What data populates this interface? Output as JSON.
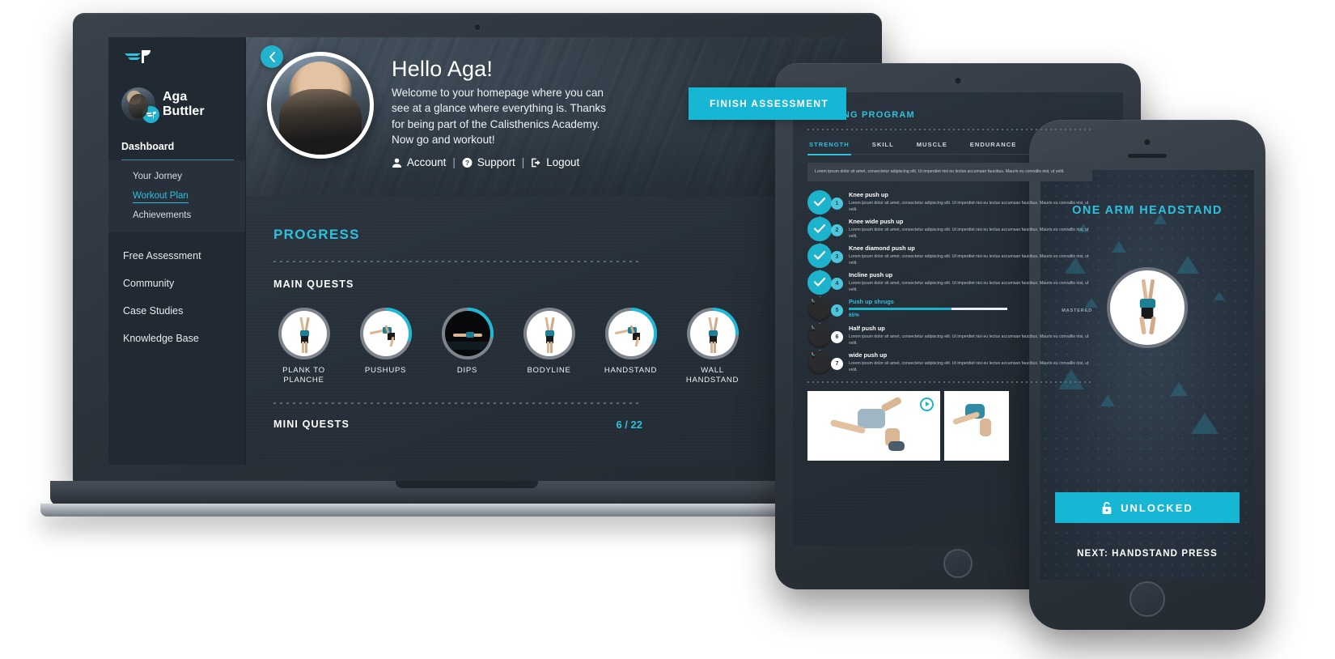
{
  "brand": {
    "logo_icon": "wing-logo-icon",
    "accent": "#22b2cd",
    "accent_dark": "#16b6d4"
  },
  "laptop": {
    "back_button_icon": "chevron-left-icon",
    "sidebar": {
      "user": {
        "name_line1": "Aga",
        "name_line2": "Buttler",
        "badge_icon": "wing-badge-icon"
      },
      "section_label": "Dashboard",
      "sub_items": [
        {
          "label": "Your Jorney",
          "active": false
        },
        {
          "label": "Workout Plan",
          "active": true
        },
        {
          "label": "Achievements",
          "active": false
        }
      ],
      "items": [
        {
          "label": "Free Assessment"
        },
        {
          "label": "Community"
        },
        {
          "label": "Case Studies"
        },
        {
          "label": "Knowledge Base"
        }
      ]
    },
    "hero": {
      "greeting": "Hello Aga!",
      "welcome": "Welcome to your homepage where you can see at a glance where everything is. Thanks for being part of the Calisthenics Academy. Now go and workout!",
      "links": [
        {
          "label": "Account",
          "icon": "user-icon"
        },
        {
          "label": "Support",
          "icon": "question-circle-icon"
        },
        {
          "label": "Logout",
          "icon": "logout-icon"
        }
      ],
      "separator": "|",
      "cta_label": "FINISH ASSESSMENT"
    },
    "progress": {
      "title": "PROGRESS",
      "main_quests_label": "MAIN QUESTS",
      "quests": [
        {
          "label": "PLANK TO PLANCHE",
          "percent": 0,
          "dark_photo": false
        },
        {
          "label": "PUSHUPS",
          "percent": 30,
          "dark_photo": false
        },
        {
          "label": "DIPS",
          "percent": 28,
          "dark_photo": true
        },
        {
          "label": "BODYLINE",
          "percent": 0,
          "dark_photo": false
        },
        {
          "label": "HANDSTAND",
          "percent": 32,
          "dark_photo": false
        },
        {
          "label": "WALL HANDSTAND",
          "percent": 26,
          "dark_photo": false
        }
      ],
      "mini_quests_label": "MINI QUESTS",
      "mini_quests_count": "6 / 22"
    }
  },
  "tablet": {
    "title": "TRAINING PROGRAM",
    "tabs": [
      {
        "label": "STRENGTH",
        "active": true
      },
      {
        "label": "SKILL",
        "active": false
      },
      {
        "label": "MUSCLE",
        "active": false
      },
      {
        "label": "ENDURANCE",
        "active": false
      }
    ],
    "intro": "Lorem ipsum dolor sit amet, consectetur adipiscing elit. Ut imperdiet nisi eu lectus accumsan faucibus. Mauris eu convallis nisi, ut velit.",
    "mastered_label": "MASTERED",
    "items": [
      {
        "num": "1",
        "title": "Knee push up",
        "desc": "Lorem ipsum dolor sit amet, consectetur adipiscing elit. Ut imperdiet nisi eu lectus accumsan faucibus. Mauris eu convallis nisi, ut velit.",
        "state": "done"
      },
      {
        "num": "2",
        "title": "Knee wide push up",
        "desc": "Lorem ipsum dolor sit amet, consectetur adipiscing elit. Ut imperdiet nisi eu lectus accumsan faucibus. Mauris eu convallis nisi, ut velit.",
        "state": "done"
      },
      {
        "num": "3",
        "title": "Knee diamond push up",
        "desc": "Lorem ipsum dolor sit amet, consectetur adipiscing elit. Ut imperdiet nisi eu lectus accumsan faucibus. Mauris eu convallis nisi, ut velit.",
        "state": "done"
      },
      {
        "num": "4",
        "title": "Incline push up",
        "desc": "Lorem ipsum dolor sit amet, consectetur adipiscing elit. Ut imperdiet nisi eu lectus accumsan faucibus. Mauris eu convallis nisi, ut velit.",
        "state": "done"
      },
      {
        "num": "5",
        "title": "Push up shrugs",
        "desc": "",
        "state": "current",
        "percent_label": "65%",
        "percent": 65
      },
      {
        "num": "6",
        "title": "Half push up",
        "desc": "Lorem ipsum dolor sit amet, consectetur adipiscing elit. Ut imperdiet nisi eu lectus accumsan faucibus. Mauris eu convallis nisi, ut velit.",
        "state": "locked"
      },
      {
        "num": "7",
        "title": "wide push up",
        "desc": "Lorem ipsum dolor sit amet, consectetur adipiscing elit. Ut imperdiet nisi eu lectus accumsan faucibus. Mauris eu convallis nisi, ut velit.",
        "state": "locked"
      }
    ],
    "play_icon": "play-circle-icon"
  },
  "phone": {
    "title": "ONE ARM HEADSTAND",
    "unlock_label": "UNLOCKED",
    "unlock_icon": "unlock-icon",
    "next_label": "NEXT: HANDSTAND PRESS"
  }
}
